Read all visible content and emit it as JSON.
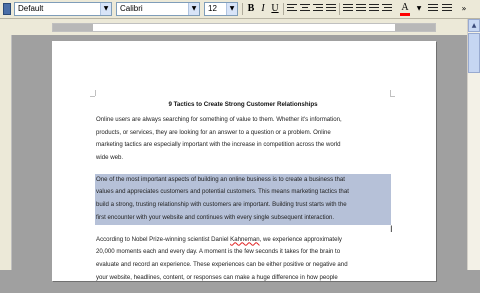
{
  "toolbar": {
    "style_value": "Default",
    "font_value": "Calibri",
    "size_value": "12",
    "bold_label": "B",
    "italic_label": "I",
    "underline_label": "U",
    "font_color_label": "A",
    "font_color": "#ff0000"
  },
  "document": {
    "title": "9 Tactics to Create Strong Customer Relationships",
    "paragraphs": [
      {
        "selected": false,
        "lines": [
          "Online users are always searching for something of value to them. Whether it's information,",
          "products, or services, they are looking for an answer to a question or a problem. Online",
          "marketing tactics are especially important with the increase in competition across the world",
          "wide web."
        ]
      },
      {
        "selected": true,
        "lines": [
          "One of the most important aspects of building an online business is to create a business that",
          "values and appreciates customers and potential customers. This means marketing tactics that",
          "build a strong, trusting relationship with customers are important. Building trust starts with the",
          "first encounter with your website and continues with every single subsequent interaction."
        ]
      },
      {
        "selected": false,
        "lines": [
          "According to Nobel Prize-winning scientist Daniel Kahneman, we experience approximately",
          "20,000 moments each and every day. A moment is the few seconds it takes for the brain to",
          "evaluate and record an experience. These experiences can be either positive or negative and",
          "your website, headlines, content, or responses can make a huge difference in how people"
        ]
      }
    ],
    "misspelled_word": "Kahneman"
  }
}
